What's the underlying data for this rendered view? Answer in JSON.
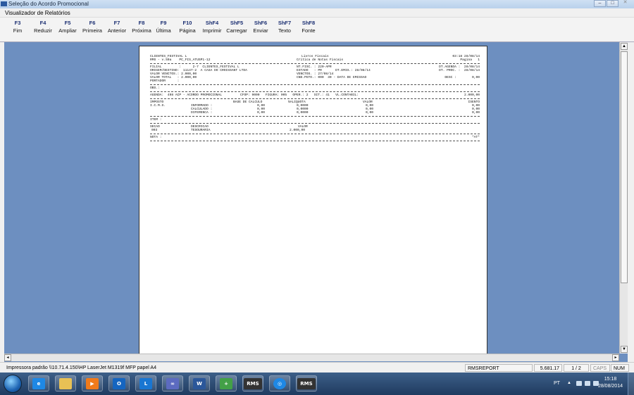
{
  "outer_window": {
    "title": "Seleção do Acordo Promocional"
  },
  "inner_window": {
    "title": "Visualizador de Relatórios"
  },
  "toolbar": [
    {
      "key": "F3",
      "label": "Fim"
    },
    {
      "key": "F4",
      "label": "Reduzir"
    },
    {
      "key": "F5",
      "label": "Ampliar"
    },
    {
      "key": "F6",
      "label": "Primeira"
    },
    {
      "key": "F7",
      "label": "Anterior"
    },
    {
      "key": "F8",
      "label": "Próxima"
    },
    {
      "key": "F9",
      "label": "Última"
    },
    {
      "key": "F10",
      "label": "Página"
    },
    {
      "key": "ShF4",
      "label": "Imprimir"
    },
    {
      "key": "ShF5",
      "label": "Carregar"
    },
    {
      "key": "ShF6",
      "label": "Enviar"
    },
    {
      "key": "ShF7",
      "label": "Texto"
    },
    {
      "key": "ShF8",
      "label": "Fonte"
    }
  ],
  "report": {
    "h1": {
      "left": "CLIENTES_FESTIVAL L",
      "center": "Livros Fiscais",
      "right": "03:18 28/08/14"
    },
    "h2": {
      "left": "RMS - v.S0a    PC_FIS_ATUSP1-12",
      "center": "Critica de Notas Fiscais",
      "right": "Pagina   1"
    },
    "info": [
      {
        "a": "FILIAL         :      2-7  CLIENTES_FESTIVAL L",
        "b": "NT.FISC. : 220-APR",
        "c": "DT.AGENDA :  28/08/14"
      },
      {
        "a": "ORIGEM/DESTINO:  11147-2  A CASA DO CROISSANT LTDA",
        "b": "ESTADO   : PR       DT.EMIS.: 28/08/14",
        "c": "DT. PROC. :  28/08/14"
      },
      {
        "a": "VALOR VENCTOS.: 2.000,00",
        "b": "VENCTOS. : 27/08/14",
        "c": ""
      },
      {
        "a": "VALOR TOTAL   : 2.000,00",
        "b": "CND.PGTO.: 000  30 - DATA DE EMISSAO",
        "c": "DESC :        0,00"
      },
      {
        "a": "PORTADOR      :",
        "b": "",
        "c": ""
      }
    ],
    "obs": "OBS.:",
    "agenda": {
      "left": "AGENDA:  498 ACP - ACORDO PROMOCIONAL",
      "mid": "CFOP: 9000   FIGURA: 005   OPER.: 2   SIT.: 41   VL.CONTABIL:",
      "right": "2.000,00"
    },
    "tax_header": [
      "IMPOSTO",
      "BASE DE CALCULO",
      "%ALIQUOTA",
      "VALOR",
      "ISENTO"
    ],
    "tax_rows": [
      [
        "I.C.M.S.",
        "INFORMADO :",
        "0,00",
        "0,0000",
        "0,00",
        "0,00"
      ],
      [
        "",
        "CALCULADO :",
        "0,00",
        "0,0000",
        "0,00",
        "0,00"
      ],
      [
        "",
        "DIFERENCA :",
        "0,00",
        "0,0000",
        "0,00",
        "0,00"
      ]
    ],
    "item": "ITEM :",
    "sec_header": [
      "SECAO",
      "DESCRICAO",
      "VALOR"
    ],
    "sec_row": [
      "003",
      "TESOURARIA",
      "2.000,00"
    ],
    "nota": {
      "left": "NOTA :",
      "right": "*AT*"
    }
  },
  "status_bar": {
    "printer": "Impressora padrão \\\\10.71.4.150\\HP LaserJet M1319f MFP papel A4",
    "report": "RMSREPORT",
    "value": "5.681.17",
    "page": "1 / 2",
    "caps": "CAPS",
    "num": "NUM"
  },
  "taskbar": {
    "lang": "PT",
    "time": "15:18",
    "date": "28/08/2014",
    "apps": [
      "ie-icon",
      "explorer-icon",
      "media-icon",
      "outlook-icon",
      "lync-icon",
      "app-icon",
      "word-icon",
      "tool-icon",
      "rms-icon",
      "network-icon",
      "rms-icon"
    ]
  }
}
